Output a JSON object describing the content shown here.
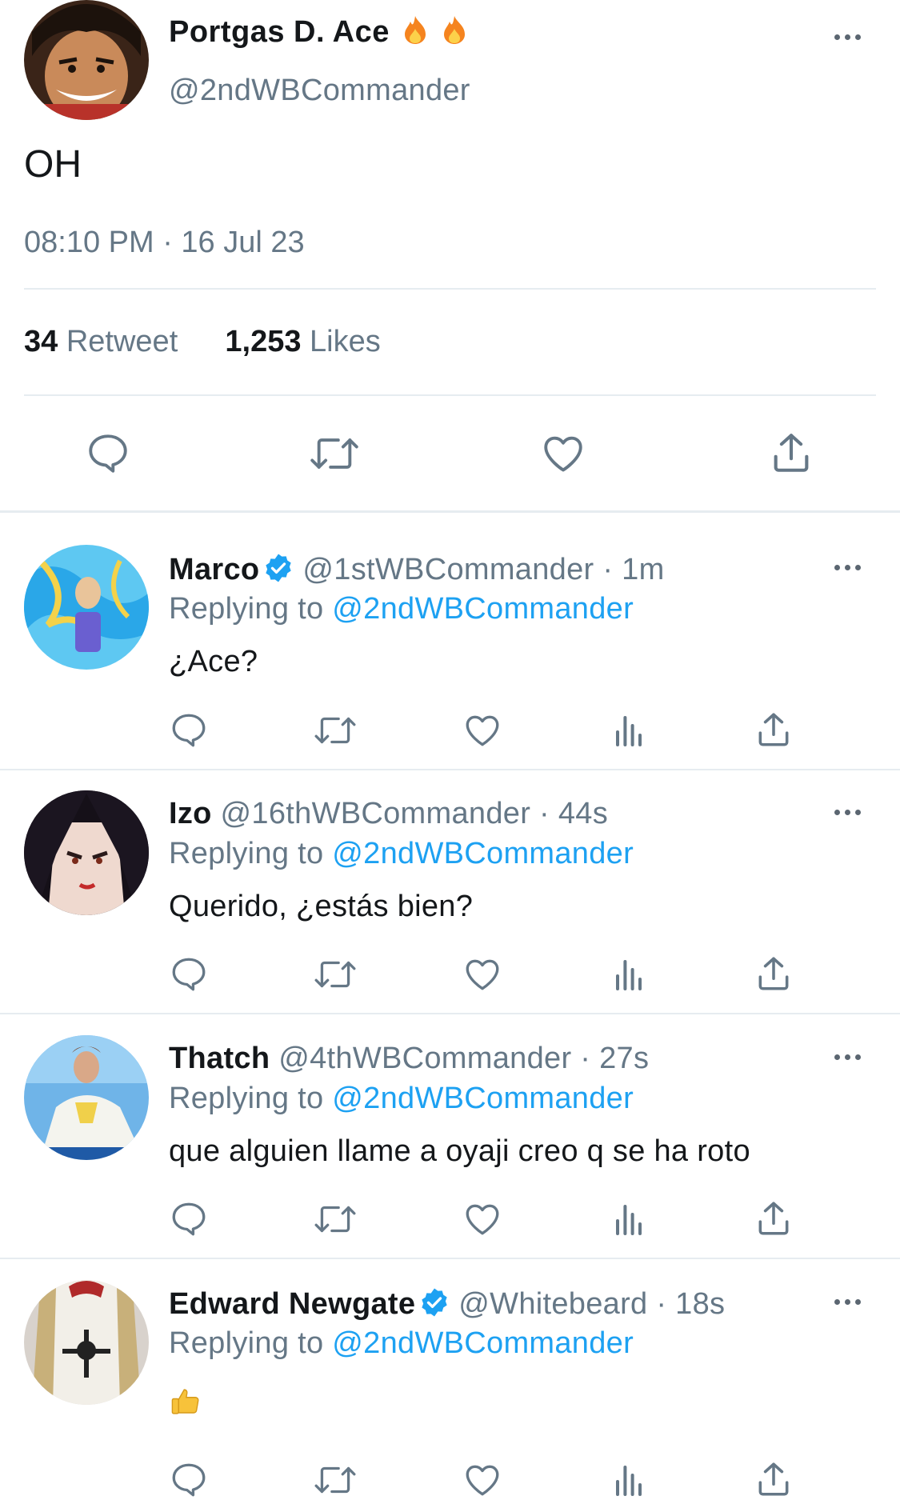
{
  "main_tweet": {
    "author_name": "Portgas D. Ace",
    "author_emoji": [
      "fire-icon",
      "fire-icon"
    ],
    "handle": "@2ndWBCommander",
    "text": "OH",
    "timestamp": "08:10 PM · 16 Jul 23",
    "retweet_count": "34",
    "retweet_label": "Retweet",
    "likes_count": "1,253",
    "likes_label": "Likes"
  },
  "replies": [
    {
      "name": "Marco",
      "verified": true,
      "handle_time": "@1stWBCommander · 1m",
      "replying_prefix": "Replying to",
      "replying_handle": "@2ndWBCommander",
      "text": "¿Ace?"
    },
    {
      "name": "Izo",
      "verified": false,
      "handle_time": "@16thWBCommander · 44s",
      "replying_prefix": "Replying to",
      "replying_handle": "@2ndWBCommander",
      "text": "Querido, ¿estás bien?"
    },
    {
      "name": "Thatch",
      "verified": false,
      "handle_time": "@4thWBCommander · 27s",
      "replying_prefix": "Replying to",
      "replying_handle": "@2ndWBCommander",
      "text": "que alguien llame a oyaji creo q se ha roto"
    },
    {
      "name": "Edward Newgate",
      "verified": true,
      "handle_time": "@Whitebeard · 18s",
      "replying_prefix": "Replying to",
      "replying_handle": "@2ndWBCommander",
      "text": "👍",
      "text_icon": "thumbs-up-icon"
    }
  ],
  "colors": {
    "accent": "#1da1f2",
    "secondary_text": "#657786",
    "icon": "#657786",
    "divider": "#e6ecf0"
  }
}
